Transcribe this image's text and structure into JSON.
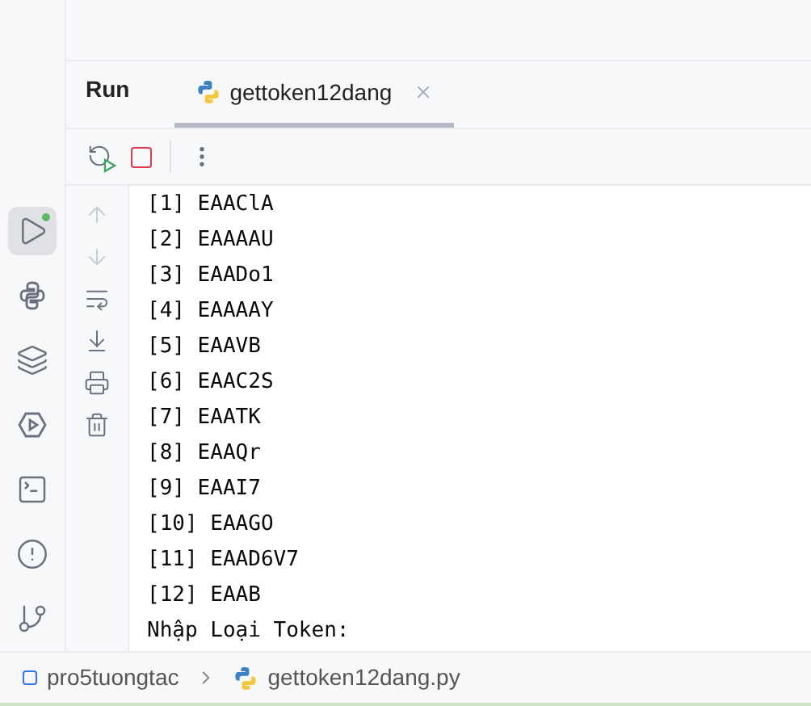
{
  "sidebar": {
    "items": [
      {
        "kind": "run",
        "selected": true,
        "badge": true
      },
      {
        "kind": "python",
        "selected": false,
        "badge": false
      },
      {
        "kind": "layers",
        "selected": false,
        "badge": false
      },
      {
        "kind": "services",
        "selected": false,
        "badge": false
      },
      {
        "kind": "terminal",
        "selected": false,
        "badge": false
      },
      {
        "kind": "problems",
        "selected": false,
        "badge": false
      },
      {
        "kind": "git",
        "selected": false,
        "badge": false
      }
    ]
  },
  "panel": {
    "title": "Run",
    "tabs": [
      {
        "label": "gettoken12dang",
        "selected": true
      }
    ]
  },
  "toolbar": [
    {
      "kind": "rerun"
    },
    {
      "kind": "stop"
    },
    {
      "kind": "more"
    }
  ],
  "gutter": [
    {
      "kind": "up",
      "disabled": true
    },
    {
      "kind": "down",
      "disabled": true
    },
    {
      "kind": "wrap",
      "disabled": false
    },
    {
      "kind": "scroll-end",
      "disabled": false
    },
    {
      "kind": "print",
      "disabled": false
    },
    {
      "kind": "clear",
      "disabled": false
    }
  ],
  "console": {
    "lines": [
      "[1] EAAClA",
      "[2] EAAAAU",
      "[3] EAADo1",
      "[4] EAAAAY",
      "[5] EAAVB",
      "[6] EAAC2S",
      "[7] EAATK",
      "[8] EAAQr",
      "[9] EAAI7",
      "[10] EAAGO",
      "[11] EAAD6V7",
      "[12] EAAB",
      "Nhập Loại Token:"
    ]
  },
  "breadcrumb": [
    {
      "kind": "module",
      "label": "pro5tuongtac"
    },
    {
      "kind": "python",
      "label": "gettoken12dang.py"
    }
  ]
}
